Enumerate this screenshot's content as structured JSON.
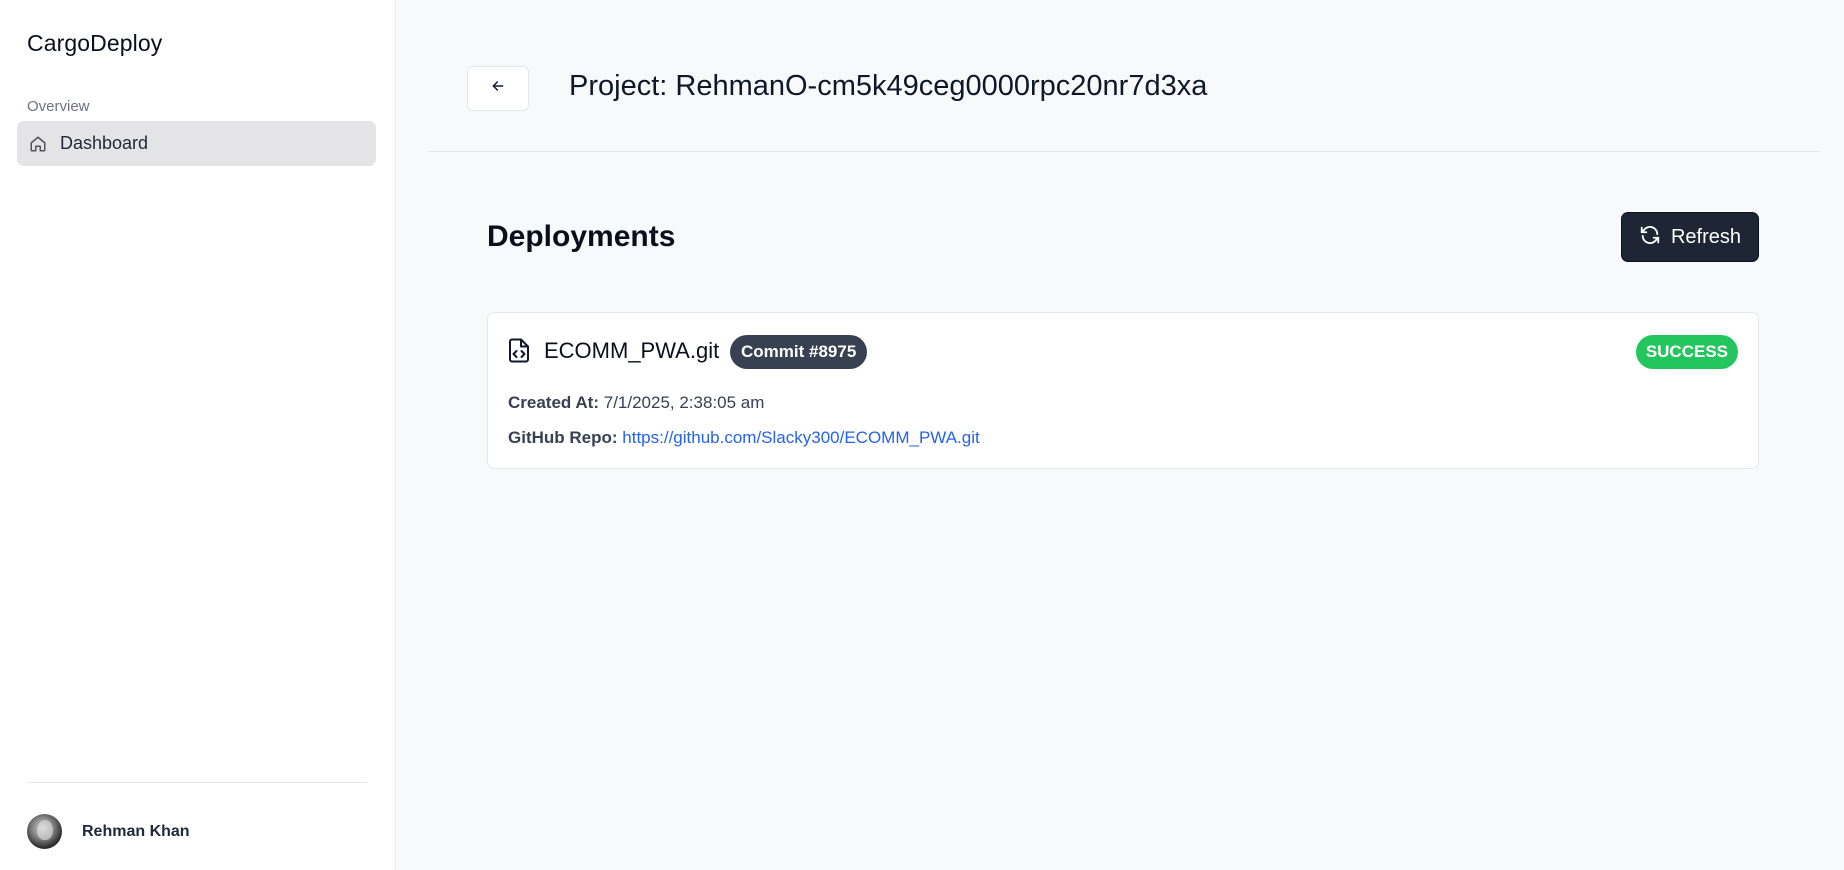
{
  "app": {
    "brand": "CargoDeploy"
  },
  "sidebar": {
    "section_label": "Overview",
    "items": [
      {
        "label": "Dashboard",
        "icon": "home-icon",
        "active": true
      }
    ],
    "user": {
      "name": "Rehman Khan"
    }
  },
  "header": {
    "back_icon": "arrow-left-icon",
    "title": "Project: RehmanO-cm5k49ceg0000rpc20nr7d3xa"
  },
  "main": {
    "heading": "Deployments",
    "refresh_label": "Refresh",
    "refresh_icon": "refresh-icon",
    "deployments": [
      {
        "repo": "ECOMM_PWA.git",
        "file_icon": "file-code-icon",
        "commit": "Commit #8975",
        "status": "SUCCESS",
        "created_at_label": "Created At:",
        "created_at": "7/1/2025, 2:38:05 am",
        "github_label": "GitHub Repo:",
        "github_url": "https://github.com/Slacky300/ECOMM_PWA.git"
      }
    ]
  },
  "colors": {
    "active_nav_bg": "#e4e4e7",
    "refresh_bg": "#1e2636",
    "commit_badge_bg": "#374151",
    "success": "#22c55e",
    "link": "#2563eb"
  }
}
